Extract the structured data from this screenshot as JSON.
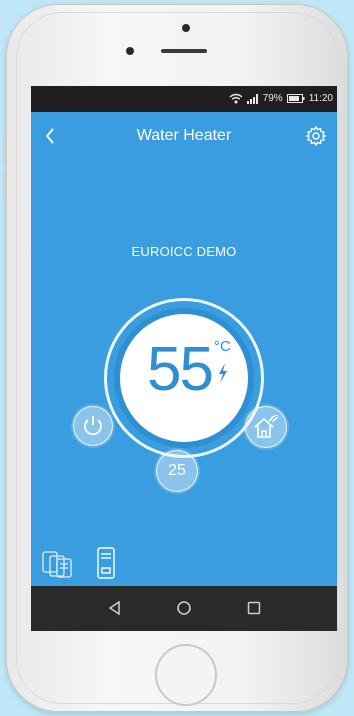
{
  "status_bar": {
    "battery": "79%",
    "time": "11:20",
    "icons": [
      "wifi-icon",
      "signal-icon",
      "battery-icon"
    ]
  },
  "header": {
    "title": "Water Heater",
    "back_icon": "chevron-left-icon",
    "settings_icon": "gear-icon"
  },
  "device": {
    "name": "EUROICC DEMO"
  },
  "temperature": {
    "value": "55",
    "unit": "°C",
    "heating_icon": "lightning-bolt-icon"
  },
  "controls": {
    "power_icon": "power-icon",
    "eco_icon": "house-leaf-icon",
    "setpoint": "25"
  },
  "device_bar": {
    "icons": [
      "multi-heater-icon",
      "single-heater-icon"
    ]
  },
  "nav": {
    "icons": [
      "back-triangle-icon",
      "home-circle-icon",
      "recents-square-icon"
    ]
  },
  "colors": {
    "app_blue": "#3a9de0",
    "ring_blue": "#2f8fd3",
    "status_bar": "#1f1f1f",
    "nav_bar": "#2a2a2a",
    "background": "#bfe6f7"
  }
}
